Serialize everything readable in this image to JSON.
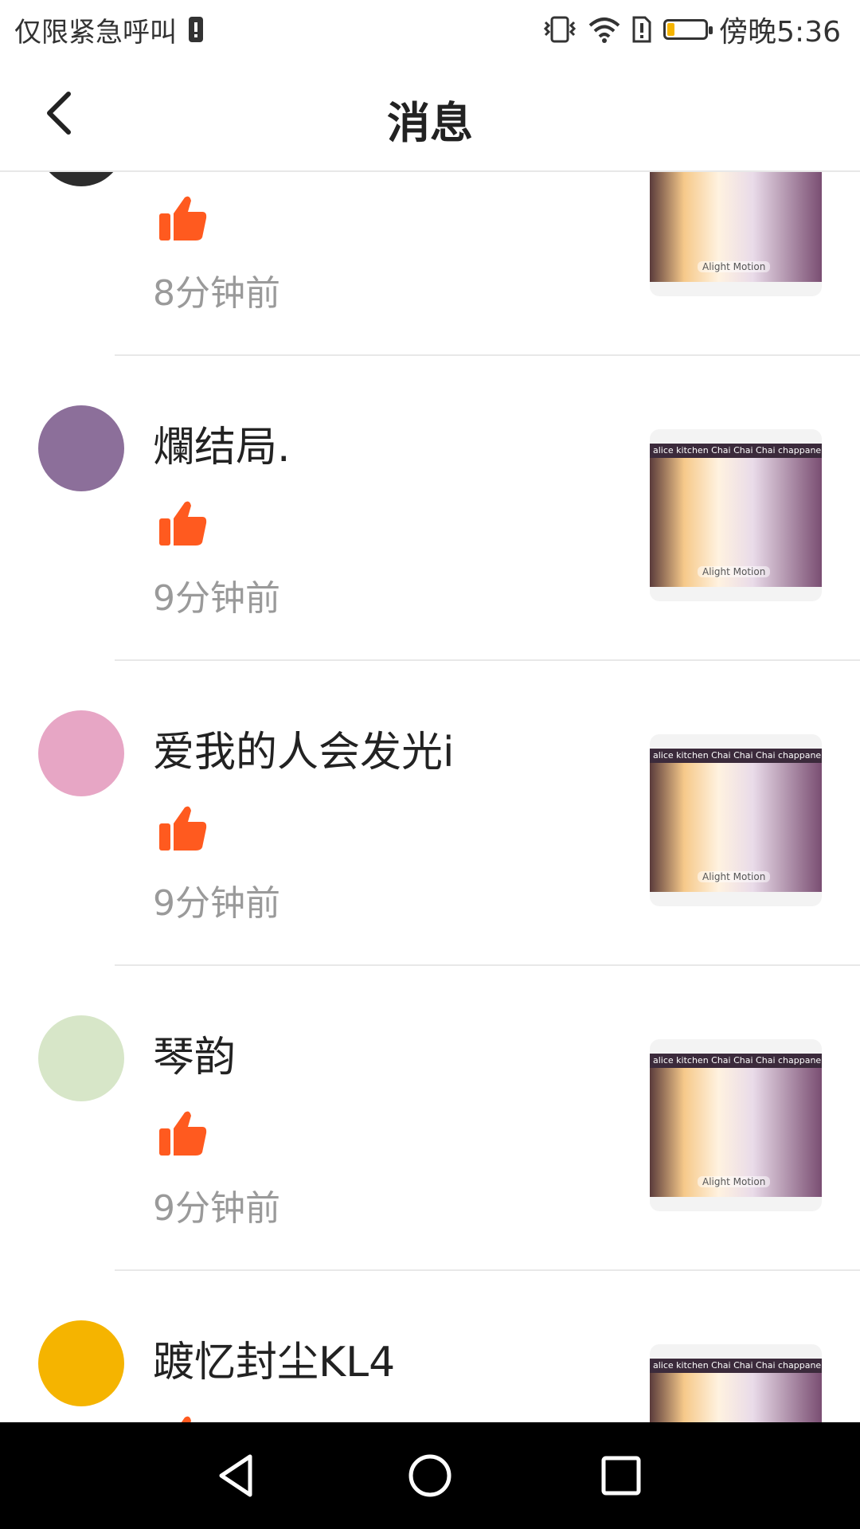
{
  "status_bar": {
    "carrier": "仅限紧急呼叫",
    "time": "傍晚5:36",
    "battery_level": 0.2,
    "battery_color": "#f5b400"
  },
  "header": {
    "title": "消息",
    "back_icon": "chevron-left-icon"
  },
  "like_color": "#ff5a1f",
  "thumb_watermark": "Alight Motion",
  "thumb_banner": "alice kitchen Chai Chai Chai chappane a sauce ...",
  "messages": [
    {
      "name": "",
      "time": "8分钟前",
      "avatar_color": "#2c2c2c"
    },
    {
      "name": "爛结局.",
      "time": "9分钟前",
      "avatar_color": "#8c6f9a"
    },
    {
      "name": "爱我的人会发光i",
      "time": "9分钟前",
      "avatar_color": "#e7a6c5"
    },
    {
      "name": "琴韵",
      "time": "9分钟前",
      "avatar_color": "#d7e6c8"
    },
    {
      "name": "踱忆封尘KL4",
      "time": "",
      "avatar_color": "#f5b400"
    }
  ]
}
